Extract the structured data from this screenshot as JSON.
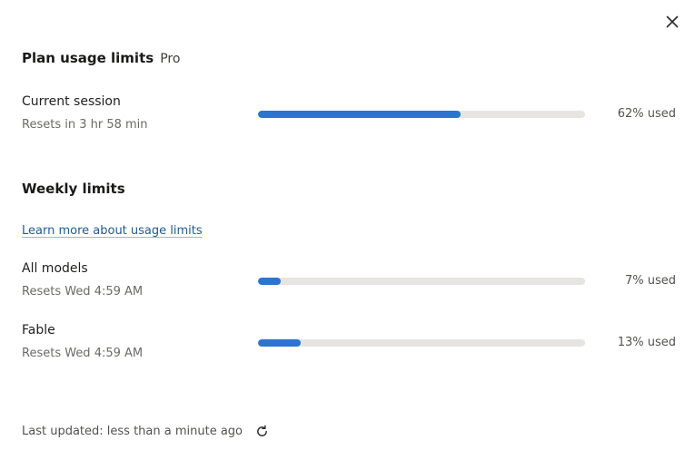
{
  "header": {
    "title": "Plan usage limits",
    "plan_badge": "Pro",
    "close_icon": "close-icon"
  },
  "colors": {
    "accent": "#2c73d2",
    "track": "#e6e5e2"
  },
  "current_session": {
    "label": "Current session",
    "reset_text": "Resets in 3 hr 58 min",
    "percent_used": 62,
    "percent_text": "62% used"
  },
  "weekly": {
    "heading": "Weekly limits",
    "learn_more_link": "Learn more about usage limits",
    "items": [
      {
        "label": "All models",
        "reset_text": "Resets Wed 4:59 AM",
        "percent_used": 7,
        "percent_text": "7% used"
      },
      {
        "label": "Fable",
        "reset_text": "Resets Wed 4:59 AM",
        "percent_used": 13,
        "percent_text": "13% used"
      }
    ]
  },
  "footer": {
    "last_updated": "Last updated: less than a minute ago",
    "refresh_icon": "refresh-icon"
  }
}
